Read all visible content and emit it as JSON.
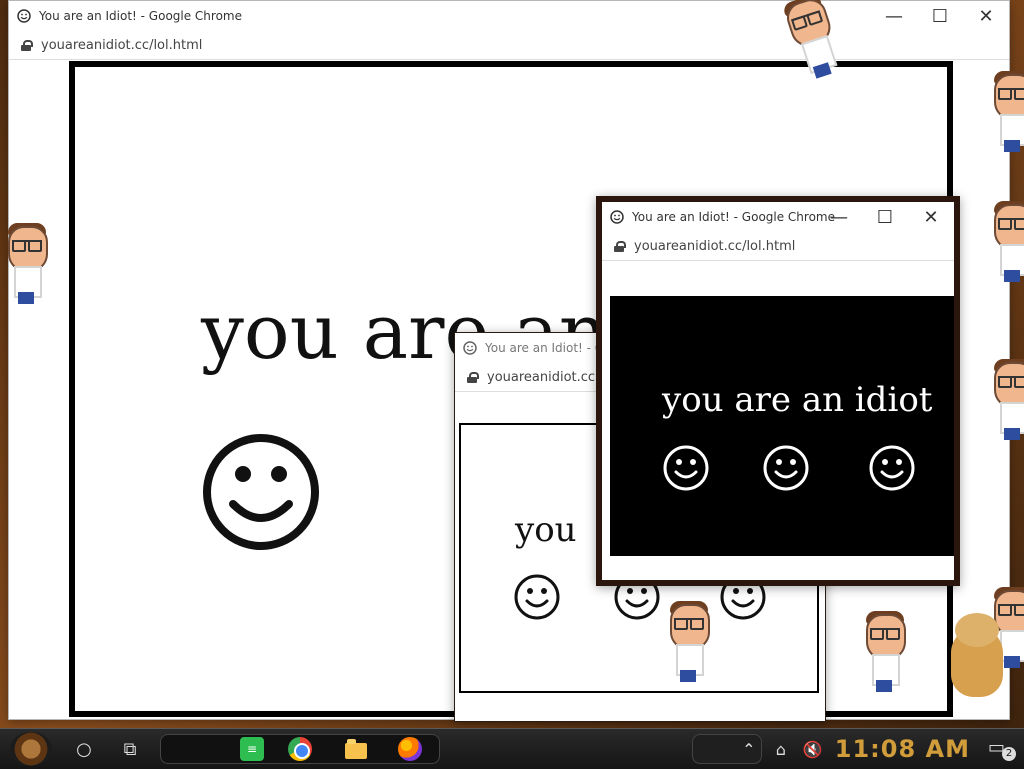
{
  "main_window": {
    "title": "You are an Idiot! - Google Chrome",
    "url": "youareanidiot.cc/lol.html",
    "content_text": "you are an"
  },
  "middle_window": {
    "title": "You are an Idiot! - G",
    "url": "youareanidiot.cc",
    "content_text": "you"
  },
  "front_window": {
    "title": "You are an Idiot! - Google Chrome",
    "url": "youareanidiot.cc/lol.html",
    "content_text": "you are an idiot"
  },
  "taskbar": {
    "clock": "11:08 AM",
    "notification_count": "2"
  }
}
